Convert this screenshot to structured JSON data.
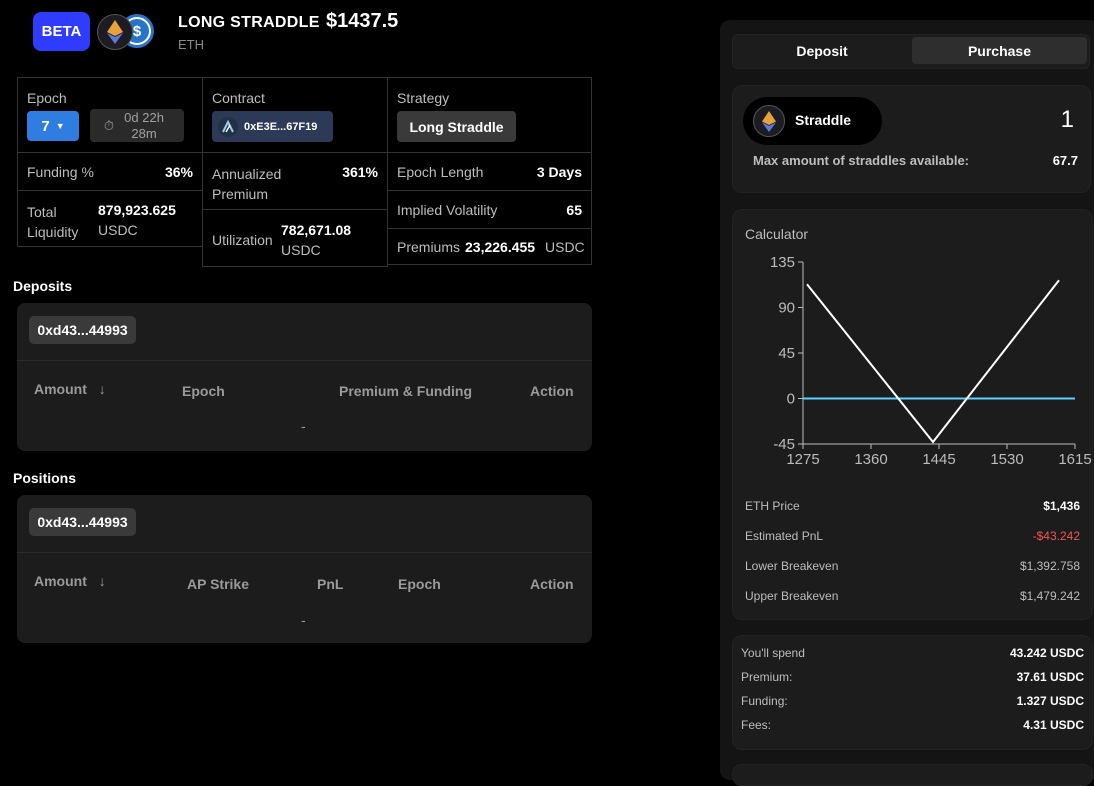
{
  "header": {
    "badge": "BETA",
    "title": "LONG STRADDLE",
    "price": "$1437.5",
    "asset": "ETH",
    "usdc_symbol": "$"
  },
  "stats": {
    "epoch_label": "Epoch",
    "epoch_value": "7",
    "epoch_timer": "0d 22h 28m",
    "contract_label": "Contract",
    "contract_value": "0xE3E...67F19",
    "strategy_label": "Strategy",
    "strategy_value": "Long Straddle",
    "funding_label": "Funding %",
    "funding_value": "36%",
    "annualized_label": "Annualized Premium",
    "annualized_value": "361%",
    "epoch_length_label": "Epoch Length",
    "epoch_length_value": "3 Days",
    "total_liquidity_label": "Total Liquidity",
    "total_liquidity_value": "879,923.625",
    "total_liquidity_unit": "USDC",
    "utilization_label": "Utilization",
    "utilization_value": "782,671.08",
    "utilization_unit": "USDC",
    "iv_label": "Implied Volatility",
    "iv_value": "65",
    "premiums_label": "Premiums",
    "premiums_value": "23,226.455",
    "premiums_unit": "USDC"
  },
  "deposits": {
    "title": "Deposits",
    "address": "0xd43...44993",
    "columns": [
      "Amount",
      "Epoch",
      "Premium & Funding",
      "Action"
    ],
    "empty": "-"
  },
  "positions": {
    "title": "Positions",
    "address": "0xd43...44993",
    "columns": [
      "Amount",
      "AP Strike",
      "PnL",
      "Epoch",
      "Action"
    ],
    "empty": "-"
  },
  "right": {
    "tabs": [
      "Deposit",
      "Purchase"
    ],
    "active_tab": "Purchase",
    "straddle_label": "Straddle",
    "straddle_qty": "1",
    "max_label": "Max amount of straddles available:",
    "max_value": "67.7",
    "calculator_title": "Calculator",
    "calc_rows": [
      {
        "label": "ETH Price",
        "value": "$1,436"
      },
      {
        "label": "Estimated PnL",
        "value": "-$43.242"
      },
      {
        "label": "Lower Breakeven",
        "value": "$1,392.758"
      },
      {
        "label": "Upper Breakeven",
        "value": "$1,479.242"
      }
    ],
    "summary_rows": [
      {
        "label": "You'll spend",
        "value": "43.242 USDC"
      },
      {
        "label": "Premium:",
        "value": "37.61 USDC"
      },
      {
        "label": "Funding:",
        "value": "1.327 USDC"
      },
      {
        "label": "Fees:",
        "value": "4.31 USDC"
      }
    ]
  },
  "chart_data": {
    "type": "line",
    "x_ticks": [
      1275,
      1360,
      1445,
      1530,
      1615
    ],
    "y_ticks": [
      135,
      90,
      45,
      0,
      -45
    ],
    "xlim": [
      1275,
      1615
    ],
    "ylim": [
      -45,
      135
    ],
    "series": [
      {
        "color": "#ffffff",
        "x": [
          1280,
          1437.5,
          1595
        ],
        "y": [
          113,
          -43,
          117
        ]
      },
      {
        "color": "#5bd1ff",
        "x": [
          1275,
          1615
        ],
        "y": [
          0,
          0
        ]
      }
    ]
  },
  "colors": {
    "accent": "#2f3cff",
    "negative": "#f05454",
    "zero_line": "#5bd1ff"
  }
}
